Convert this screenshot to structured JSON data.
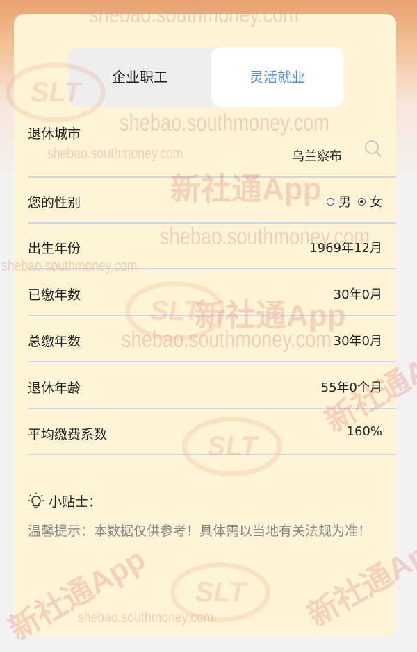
{
  "tabs": [
    {
      "label": "企业职工",
      "active": false
    },
    {
      "label": "灵活就业",
      "active": true
    }
  ],
  "form": {
    "retire_city": {
      "label": "退休城市",
      "value": "乌兰察布",
      "icon": "search-icon"
    },
    "gender": {
      "label": "您的性别",
      "options": [
        "男",
        "女"
      ],
      "selected": "女"
    },
    "birth_year": {
      "label": "出生年份",
      "value": "1969年12月"
    },
    "paid_years": {
      "label": "已缴年数",
      "value": "30年0月"
    },
    "total_years": {
      "label": "总缴年数",
      "value": "30年0月"
    },
    "retire_age": {
      "label": "退休年龄",
      "value": "55年0个月"
    },
    "avg_coefficient": {
      "label": "平均缴费系数",
      "value": "160%"
    }
  },
  "tips": {
    "title": "小贴士：",
    "icon": "lightbulb-icon",
    "text": "温馨提示：本数据仅供参考！具体需以当地有关法规为准！"
  },
  "watermark": {
    "url": "shebao.southmoney.com",
    "brand": "新社通App",
    "logo": "SLT"
  },
  "colors": {
    "accent": "#4a8fe0",
    "card_bg": "#fff5d6",
    "divider": "#c9d8ec",
    "header_orange": "#e8a16d"
  }
}
